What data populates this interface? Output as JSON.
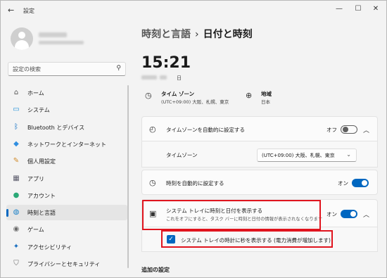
{
  "window": {
    "back_icon": "←",
    "title": "設定",
    "minimize": "—",
    "maximize": "☐",
    "close": "✕"
  },
  "sidebar": {
    "search_placeholder": "設定の検索",
    "items": [
      {
        "label": "ホーム",
        "icon": "home-icon",
        "glyph": "⌂",
        "color": "#555555"
      },
      {
        "label": "システム",
        "icon": "monitor-icon",
        "glyph": "▭",
        "color": "#1f8fd8"
      },
      {
        "label": "Bluetooth とデバイス",
        "icon": "bluetooth-icon",
        "glyph": "ᛒ",
        "color": "#0067c0"
      },
      {
        "label": "ネットワークとインターネット",
        "icon": "wifi-icon",
        "glyph": "◆",
        "color": "#2f8ee0"
      },
      {
        "label": "個人用設定",
        "icon": "brush-icon",
        "glyph": "✎",
        "color": "#d08a2a"
      },
      {
        "label": "アプリ",
        "icon": "apps-icon",
        "glyph": "▦",
        "color": "#5a5a6a"
      },
      {
        "label": "アカウント",
        "icon": "account-icon",
        "glyph": "●",
        "color": "#2aa876"
      },
      {
        "label": "時刻と言語",
        "icon": "globe-clock-icon",
        "glyph": "◍",
        "color": "#1a80c8"
      },
      {
        "label": "ゲーム",
        "icon": "gamepad-icon",
        "glyph": "◉",
        "color": "#6b6b6b"
      },
      {
        "label": "アクセシビリティ",
        "icon": "accessibility-icon",
        "glyph": "✦",
        "color": "#1a6fc0"
      },
      {
        "label": "プライバシーとセキュリティ",
        "icon": "shield-icon",
        "glyph": "⛉",
        "color": "#6b6b6b"
      }
    ],
    "active_index": 7
  },
  "breadcrumb": {
    "parent": "時刻と言語",
    "separator": "›",
    "current": "日付と時刻"
  },
  "clock": {
    "time": "15:21",
    "date_suffix": "日"
  },
  "timezone_info": {
    "title": "タイム ゾーン",
    "value": "(UTC+09:00) 大阪、札幌、東京"
  },
  "region_info": {
    "title": "地域",
    "value": "日本"
  },
  "settings": {
    "auto_timezone": {
      "label": "タイムゾーンを自動的に設定する",
      "state": "オフ"
    },
    "timezone_row": {
      "label": "タイムゾーン",
      "selected": "(UTC+09:00) 大阪、札幌、東京"
    },
    "auto_time": {
      "label": "時刻を自動的に設定する",
      "state": "オン"
    },
    "tray": {
      "label": "システム トレイに時刻と日付を表示する",
      "sub": "これをオフにすると、タスク バーに時刻と日付の情報が表示されなくなります",
      "state": "オン"
    },
    "seconds": {
      "label": "システム トレイの時計に秒を表示する (電力消費が増加します)",
      "checked": true
    }
  },
  "additional_settings": "追加の設定",
  "colors": {
    "accent": "#0067c0",
    "highlight": "#e0141e"
  }
}
